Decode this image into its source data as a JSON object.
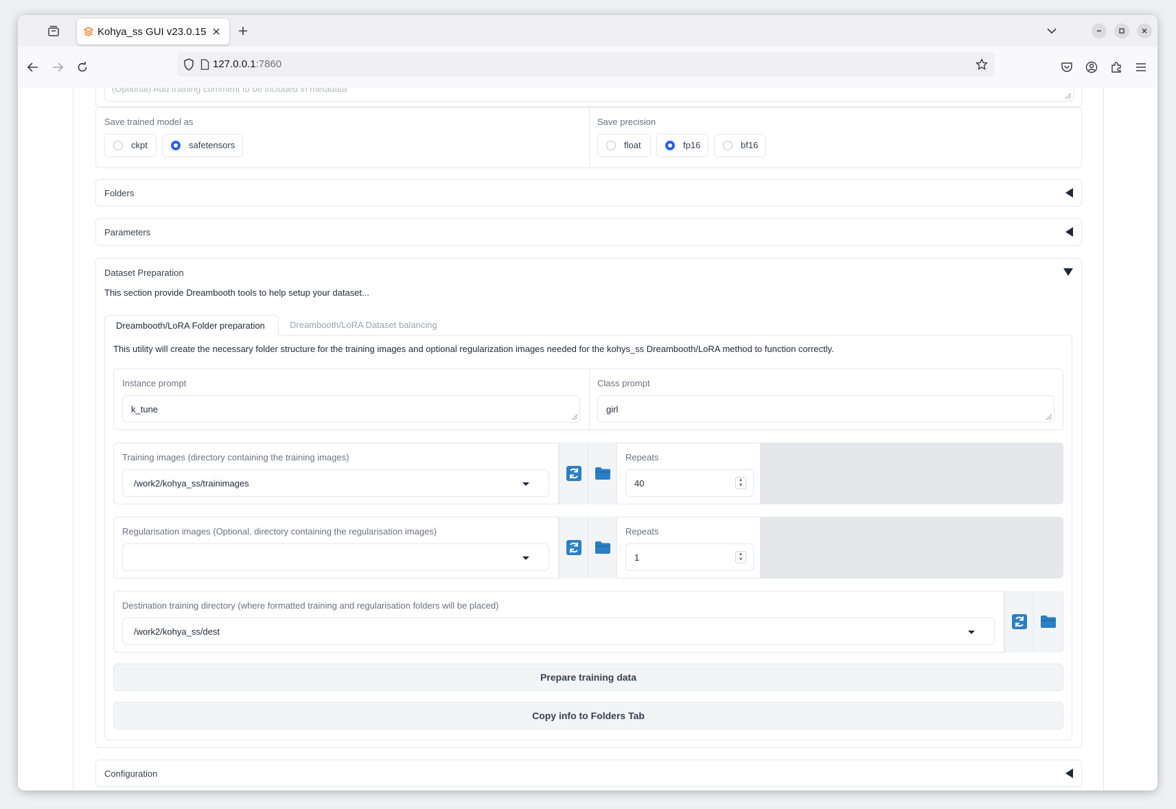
{
  "browser": {
    "tab_title": "Kohya_ss GUI v23.0.15",
    "url_host": "127.0.0.1",
    "url_port": ":7860"
  },
  "metadata_comment": {
    "placeholder": "(Optional) Add training comment to be included in metadata"
  },
  "save_model": {
    "label": "Save trained model as",
    "options": [
      "ckpt",
      "safetensors"
    ],
    "selected": "safetensors"
  },
  "save_precision": {
    "label": "Save precision",
    "options": [
      "float",
      "fp16",
      "bf16"
    ],
    "selected": "fp16"
  },
  "accordions": {
    "folders": "Folders",
    "parameters": "Parameters",
    "dataset_preparation": "Dataset Preparation",
    "configuration": "Configuration"
  },
  "dataset": {
    "description": "This section provide Dreambooth tools to help setup your dataset...",
    "tabs": [
      "Dreambooth/LoRA Folder preparation",
      "Dreambooth/LoRA Dataset balancing"
    ],
    "active_tab": "Dreambooth/LoRA Folder preparation",
    "utility_text": "This utility will create the necessary folder structure for the training images and optional regularization images needed for the kohys_ss Dreambooth/LoRA method to function correctly.",
    "instance_prompt": {
      "label": "Instance prompt",
      "value": "k_tune"
    },
    "class_prompt": {
      "label": "Class prompt",
      "value": "girl"
    },
    "training_images": {
      "label": "Training images (directory containing the training images)",
      "value": "/work2/kohya_ss/trainimages",
      "repeats_label": "Repeats",
      "repeats": "40"
    },
    "regularisation_images": {
      "label": "Regularisation images (Optional. directory containing the regularisation images)",
      "value": "",
      "repeats_label": "Repeats",
      "repeats": "1"
    },
    "destination": {
      "label": "Destination training directory (where formatted training and regularisation folders will be placed)",
      "value": "/work2/kohya_ss/dest"
    },
    "prepare_button": "Prepare training data",
    "copy_button": "Copy info to Folders Tab"
  },
  "colors": {
    "accent": "#2563eb",
    "tool_icon": "#2b7fc4",
    "bottom_progress": "#fdd9a8"
  },
  "icons": [
    "tab-list-icon",
    "firefox-tab-favicon",
    "close-icon",
    "plus-icon",
    "chevron-down-icon",
    "minimize-icon",
    "maximize-icon",
    "close-window-icon",
    "back-icon",
    "forward-icon",
    "reload-icon",
    "shield-icon",
    "page-icon",
    "star-icon",
    "pocket-icon",
    "account-icon",
    "extensions-icon",
    "menu-icon",
    "refresh-icon",
    "folder-icon"
  ]
}
